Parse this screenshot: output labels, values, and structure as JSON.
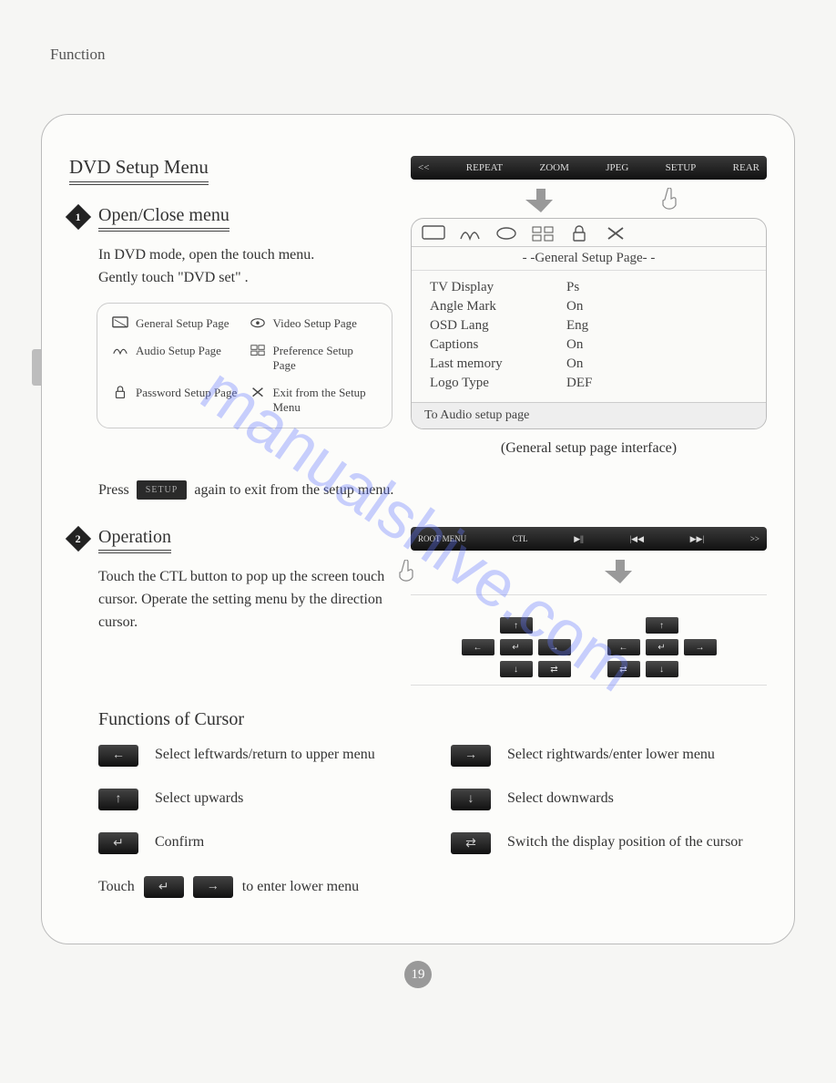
{
  "header": "Function",
  "title": "DVD  Setup  Menu",
  "step1": {
    "num": "1",
    "title": "Open/Close  menu",
    "body": "In DVD mode, open the touch menu.\nGently touch \"DVD set\" .",
    "legend": {
      "general": "General  Setup  Page",
      "video": "Video  Setup  Page",
      "audio": "Audio  Setup  Page",
      "preference": "Preference  Setup Page",
      "password": "Password Setup  Page",
      "exit": "Exit from the Setup Menu"
    },
    "press_before": "Press",
    "press_btn": "SETUP",
    "press_after": "again to exit from the setup menu."
  },
  "toolbar1": [
    "<<",
    "REPEAT",
    "ZOOM",
    "JPEG",
    "SETUP",
    "REAR"
  ],
  "panel": {
    "heading": "- -General  Setup  Page- -",
    "rows": [
      {
        "k": "TV  Display",
        "v": "Ps"
      },
      {
        "k": "Angle Mark",
        "v": "On"
      },
      {
        "k": "OSD  Lang",
        "v": "Eng"
      },
      {
        "k": "Captions",
        "v": "On"
      },
      {
        "k": "Last  memory",
        "v": "On"
      },
      {
        "k": "Logo  Type",
        "v": "DEF"
      }
    ],
    "footer": "To  Audio  setup  page",
    "caption": "(General setup page interface)"
  },
  "step2": {
    "num": "2",
    "title": "Operation",
    "body": "Touch the CTL button to pop up  the screen touch cursor. Operate the setting menu by the direction cursor."
  },
  "toolbar2": [
    "ROOT MENU",
    "CTL",
    "▶||",
    "|◀◀",
    "▶▶|",
    ">>"
  ],
  "functions": {
    "title": "Functions of Cursor",
    "items": [
      {
        "icon": "←",
        "text": "Select leftwards/return to upper menu"
      },
      {
        "icon": "→",
        "text": "Select rightwards/enter lower menu"
      },
      {
        "icon": "↑",
        "text": "Select upwards"
      },
      {
        "icon": "↓",
        "text": "Select downwards"
      },
      {
        "icon": "↵",
        "text": "Confirm"
      },
      {
        "icon": "⇄",
        "text": "Switch the display position of the cursor"
      }
    ],
    "touch_before": "Touch",
    "touch_after": "to enter lower menu"
  },
  "page_number": "19",
  "watermark": "manualshive.com"
}
